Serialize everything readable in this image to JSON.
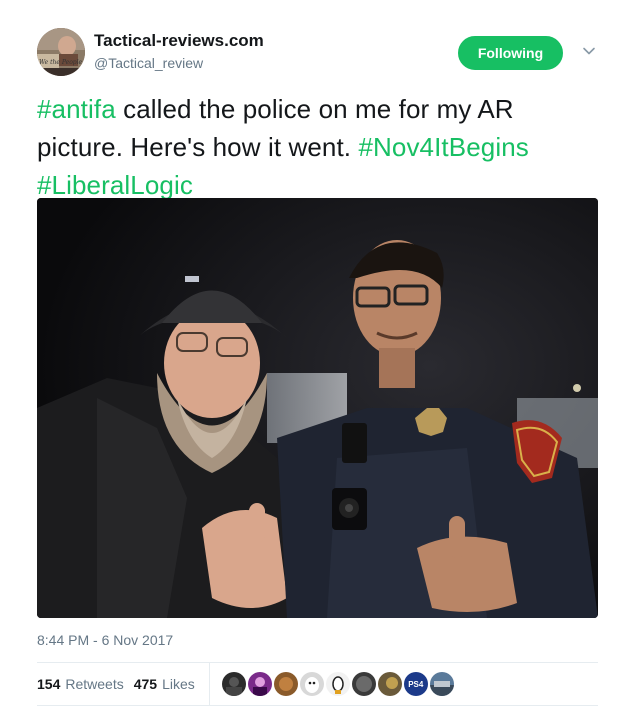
{
  "author": {
    "display_name": "Tactical-reviews.com",
    "handle": "@Tactical_review",
    "avatar_icon": "profile-avatar"
  },
  "follow_button": {
    "label": "Following",
    "color": "#17bf63"
  },
  "menu": {
    "icon": "chevron-down-icon"
  },
  "tweet": {
    "segments": [
      {
        "text": "#antifa",
        "type": "hashtag"
      },
      {
        "text": " called the police on me for my AR picture. Here's how it went. ",
        "type": "text"
      },
      {
        "text": "#Nov4ItBegins",
        "type": "hashtag"
      },
      {
        "text": " ",
        "type": "text"
      },
      {
        "text": "#LiberalLogic",
        "type": "hashtag"
      }
    ],
    "hashtag_color": "#17bf63"
  },
  "photo": {
    "alt": "",
    "icon": "tweet-photo"
  },
  "meta": {
    "timestamp": "8:44 PM - 6 Nov 2017"
  },
  "stats": {
    "retweets_count": "154",
    "retweets_label": "Retweets",
    "likes_count": "475",
    "likes_label": "Likes"
  },
  "likers": [
    {
      "icon": "liker-avatar-1",
      "color": "#2b2b2b"
    },
    {
      "icon": "liker-avatar-2",
      "color": "#7a2a8a"
    },
    {
      "icon": "liker-avatar-3",
      "color": "#8a5a2a"
    },
    {
      "icon": "liker-avatar-4",
      "color": "#d8d8d8"
    },
    {
      "icon": "liker-avatar-5",
      "color": "#f2f2f2"
    },
    {
      "icon": "liker-avatar-6",
      "color": "#3a3a3a"
    },
    {
      "icon": "liker-avatar-7",
      "color": "#6a5a3a"
    },
    {
      "icon": "liker-avatar-8",
      "color": "#1c3a8a",
      "text": "PS4"
    },
    {
      "icon": "liker-avatar-9",
      "color": "#5a7a9a"
    }
  ]
}
